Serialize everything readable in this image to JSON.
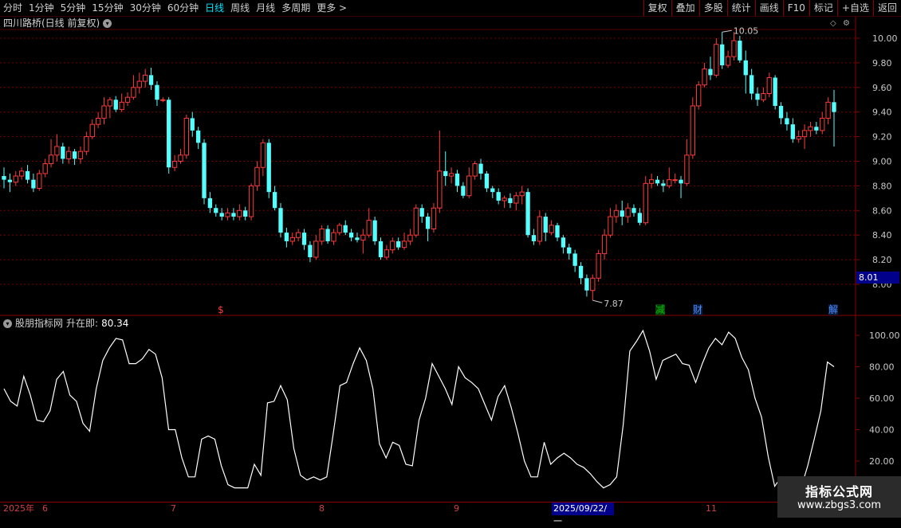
{
  "toolbar": {
    "periods": [
      {
        "label": "分时"
      },
      {
        "label": "1分钟"
      },
      {
        "label": "5分钟"
      },
      {
        "label": "15分钟"
      },
      {
        "label": "30分钟"
      },
      {
        "label": "60分钟"
      },
      {
        "label": "日线"
      },
      {
        "label": "周线"
      },
      {
        "label": "月线"
      },
      {
        "label": "多周期"
      },
      {
        "label": "更多 >"
      }
    ],
    "active_period": "日线",
    "buttons": [
      {
        "label": "复权"
      },
      {
        "label": "叠加"
      },
      {
        "label": "多股"
      },
      {
        "label": "统计"
      },
      {
        "label": "画线"
      },
      {
        "label": "F10"
      },
      {
        "label": "标记"
      },
      {
        "label": "+自选"
      },
      {
        "label": "返回"
      }
    ]
  },
  "main_chart": {
    "title": "四川路桥(日线 前复权)",
    "current_price_label": "8.01",
    "high_label": "10.05",
    "low_label": "7.87",
    "markers": {
      "s": "$",
      "jian": "减",
      "cai": "财",
      "jie": "解"
    }
  },
  "indicator": {
    "title": "股朋指标网",
    "line_label": "升在即:",
    "line_value": "80.34"
  },
  "dates": {
    "year": "2025年",
    "months": [
      "6",
      "7",
      "8",
      "9",
      "11"
    ],
    "cursor": "2025/09/22/一"
  },
  "watermark": {
    "title": "指标公式网",
    "url": "www.zbgs3.com"
  },
  "colors": {
    "up": "#ff3b3b",
    "down": "#54ffff",
    "grid": "#7a0000",
    "indicator_line": "#ffffff"
  },
  "chart_data": [
    {
      "type": "candlestick",
      "title": "四川路桥(日线 前复权)",
      "y_ticks": [
        8.0,
        8.2,
        8.4,
        8.6,
        8.8,
        9.0,
        9.2,
        9.4,
        9.6,
        9.8,
        10.0
      ],
      "ylim": [
        7.9,
        10.1
      ],
      "candles": [
        [
          8.88,
          8.85,
          8.95,
          8.78
        ],
        [
          8.85,
          8.83,
          8.9,
          8.75
        ],
        [
          8.83,
          8.88,
          8.92,
          8.8
        ],
        [
          8.88,
          8.92,
          8.95,
          8.85
        ],
        [
          8.92,
          8.85,
          8.97,
          8.82
        ],
        [
          8.85,
          8.78,
          8.9,
          8.75
        ],
        [
          8.78,
          8.9,
          8.93,
          8.76
        ],
        [
          8.9,
          8.98,
          9.02,
          8.87
        ],
        [
          8.98,
          9.05,
          9.18,
          8.95
        ],
        [
          9.05,
          9.12,
          9.22,
          9.0
        ],
        [
          9.12,
          9.02,
          9.15,
          8.98
        ],
        [
          9.02,
          9.08,
          9.12,
          8.98
        ],
        [
          9.08,
          9.02,
          9.1,
          8.97
        ],
        [
          9.02,
          9.08,
          9.12,
          8.98
        ],
        [
          9.08,
          9.2,
          9.24,
          9.05
        ],
        [
          9.2,
          9.3,
          9.34,
          9.18
        ],
        [
          9.3,
          9.35,
          9.4,
          9.27
        ],
        [
          9.35,
          9.45,
          9.52,
          9.3
        ],
        [
          9.45,
          9.5,
          9.52,
          9.35
        ],
        [
          9.5,
          9.42,
          9.53,
          9.4
        ],
        [
          9.42,
          9.48,
          9.55,
          9.4
        ],
        [
          9.48,
          9.52,
          9.56,
          9.45
        ],
        [
          9.52,
          9.6,
          9.7,
          9.5
        ],
        [
          9.6,
          9.65,
          9.72,
          9.55
        ],
        [
          9.65,
          9.7,
          9.75,
          9.6
        ],
        [
          9.7,
          9.62,
          9.76,
          9.58
        ],
        [
          9.62,
          9.5,
          9.65,
          9.45
        ],
        [
          9.5,
          9.5,
          9.52,
          9.48
        ],
        [
          9.5,
          8.95,
          9.52,
          8.9
        ],
        [
          8.95,
          9.0,
          9.05,
          8.92
        ],
        [
          9.0,
          9.05,
          9.1,
          8.98
        ],
        [
          9.05,
          9.35,
          9.38,
          9.02
        ],
        [
          9.35,
          9.25,
          9.4,
          9.2
        ],
        [
          9.25,
          9.15,
          9.28,
          9.1
        ],
        [
          9.15,
          8.7,
          9.18,
          8.65
        ],
        [
          8.7,
          8.62,
          8.75,
          8.58
        ],
        [
          8.62,
          8.58,
          8.65,
          8.55
        ],
        [
          8.58,
          8.55,
          8.62,
          8.52
        ],
        [
          8.55,
          8.58,
          8.62,
          8.52
        ],
        [
          8.58,
          8.55,
          8.62,
          8.52
        ],
        [
          8.55,
          8.6,
          8.65,
          8.52
        ],
        [
          8.6,
          8.55,
          8.63,
          8.52
        ],
        [
          8.55,
          8.8,
          8.82,
          8.52
        ],
        [
          8.8,
          8.95,
          9.0,
          8.76
        ],
        [
          8.95,
          9.15,
          9.18,
          8.88
        ],
        [
          9.15,
          8.75,
          9.18,
          8.7
        ],
        [
          8.75,
          8.62,
          8.8,
          8.6
        ],
        [
          8.62,
          8.42,
          8.66,
          8.38
        ],
        [
          8.42,
          8.35,
          8.46,
          8.3
        ],
        [
          8.35,
          8.38,
          8.42,
          8.32
        ],
        [
          8.38,
          8.42,
          8.45,
          8.35
        ],
        [
          8.42,
          8.32,
          8.45,
          8.28
        ],
        [
          8.32,
          8.22,
          8.35,
          8.18
        ],
        [
          8.22,
          8.35,
          8.4,
          8.2
        ],
        [
          8.35,
          8.45,
          8.48,
          8.32
        ],
        [
          8.45,
          8.35,
          8.48,
          8.33
        ],
        [
          8.35,
          8.42,
          8.45,
          8.32
        ],
        [
          8.42,
          8.48,
          8.5,
          8.4
        ],
        [
          8.48,
          8.42,
          8.52,
          8.4
        ],
        [
          8.42,
          8.38,
          8.45,
          8.35
        ],
        [
          8.38,
          8.36,
          8.42,
          8.34
        ],
        [
          8.36,
          8.4,
          8.45,
          8.25
        ],
        [
          8.4,
          8.52,
          8.62,
          8.38
        ],
        [
          8.52,
          8.35,
          8.55,
          8.32
        ],
        [
          8.35,
          8.22,
          8.38,
          8.2
        ],
        [
          8.22,
          8.28,
          8.32,
          8.2
        ],
        [
          8.28,
          8.35,
          8.38,
          8.25
        ],
        [
          8.35,
          8.3,
          8.38,
          8.28
        ],
        [
          8.3,
          8.35,
          8.42,
          8.28
        ],
        [
          8.35,
          8.4,
          8.45,
          8.32
        ],
        [
          8.4,
          8.62,
          8.65,
          8.38
        ],
        [
          8.62,
          8.55,
          8.65,
          8.5
        ],
        [
          8.55,
          8.45,
          8.58,
          8.35
        ],
        [
          8.45,
          8.62,
          8.66,
          8.42
        ],
        [
          8.62,
          8.92,
          9.25,
          8.58
        ],
        [
          8.92,
          8.88,
          9.08,
          8.8
        ],
        [
          8.88,
          8.9,
          8.95,
          8.82
        ],
        [
          8.9,
          8.8,
          8.93,
          8.75
        ],
        [
          8.8,
          8.72,
          8.83,
          8.7
        ],
        [
          8.72,
          8.88,
          8.95,
          8.7
        ],
        [
          8.88,
          8.98,
          9.0,
          8.85
        ],
        [
          8.98,
          8.9,
          9.02,
          8.85
        ],
        [
          8.9,
          8.78,
          8.92,
          8.75
        ],
        [
          8.78,
          8.75,
          8.8,
          8.7
        ],
        [
          8.75,
          8.68,
          8.78,
          8.65
        ],
        [
          8.68,
          8.7,
          8.72,
          8.62
        ],
        [
          8.7,
          8.66,
          8.74,
          8.62
        ],
        [
          8.66,
          8.72,
          8.75,
          8.6
        ],
        [
          8.72,
          8.75,
          8.8,
          8.65
        ],
        [
          8.75,
          8.4,
          8.78,
          8.38
        ],
        [
          8.4,
          8.35,
          8.45,
          8.32
        ],
        [
          8.35,
          8.55,
          8.6,
          8.32
        ],
        [
          8.55,
          8.42,
          8.58,
          8.35
        ],
        [
          8.42,
          8.48,
          8.52,
          8.4
        ],
        [
          8.48,
          8.38,
          8.5,
          8.35
        ],
        [
          8.38,
          8.3,
          8.4,
          8.25
        ],
        [
          8.3,
          8.25,
          8.33,
          8.2
        ],
        [
          8.25,
          8.15,
          8.28,
          8.1
        ],
        [
          8.15,
          8.05,
          8.18,
          8.0
        ],
        [
          8.05,
          7.95,
          8.08,
          7.9
        ],
        [
          7.95,
          8.05,
          8.08,
          7.87
        ],
        [
          8.05,
          8.25,
          8.28,
          8.02
        ],
        [
          8.25,
          8.4,
          8.45,
          8.2
        ],
        [
          8.4,
          8.55,
          8.62,
          8.38
        ],
        [
          8.55,
          8.6,
          8.65,
          8.5
        ],
        [
          8.6,
          8.55,
          8.68,
          8.48
        ],
        [
          8.55,
          8.62,
          8.66,
          8.5
        ],
        [
          8.62,
          8.58,
          8.65,
          8.55
        ],
        [
          8.58,
          8.5,
          8.62,
          8.48
        ],
        [
          8.5,
          8.82,
          8.88,
          8.48
        ],
        [
          8.82,
          8.85,
          8.9,
          8.78
        ],
        [
          8.85,
          8.82,
          8.88,
          8.8
        ],
        [
          8.82,
          8.8,
          8.85,
          8.75
        ],
        [
          8.8,
          8.85,
          8.95,
          8.78
        ],
        [
          8.85,
          8.85,
          8.9,
          8.82
        ],
        [
          8.85,
          8.82,
          8.88,
          8.7
        ],
        [
          8.82,
          9.05,
          9.18,
          8.8
        ],
        [
          9.05,
          9.45,
          9.52,
          9.02
        ],
        [
          9.45,
          9.62,
          9.65,
          9.42
        ],
        [
          9.62,
          9.75,
          9.8,
          9.6
        ],
        [
          9.75,
          9.7,
          9.85,
          9.66
        ],
        [
          9.7,
          9.95,
          10.0,
          9.68
        ],
        [
          9.95,
          9.78,
          10.05,
          9.75
        ],
        [
          9.78,
          9.85,
          9.9,
          9.76
        ],
        [
          9.85,
          9.98,
          10.05,
          9.82
        ],
        [
          9.98,
          9.82,
          10.02,
          9.8
        ],
        [
          9.82,
          9.7,
          9.9,
          9.55
        ],
        [
          9.7,
          9.55,
          9.75,
          9.5
        ],
        [
          9.55,
          9.5,
          9.6,
          9.45
        ],
        [
          9.5,
          9.55,
          9.6,
          9.48
        ],
        [
          9.55,
          9.68,
          9.72,
          9.52
        ],
        [
          9.68,
          9.45,
          9.7,
          9.42
        ],
        [
          9.45,
          9.35,
          9.48,
          9.3
        ],
        [
          9.35,
          9.3,
          9.4,
          9.25
        ],
        [
          9.3,
          9.18,
          9.35,
          9.15
        ],
        [
          9.18,
          9.2,
          9.25,
          9.15
        ],
        [
          9.2,
          9.25,
          9.3,
          9.1
        ],
        [
          9.25,
          9.28,
          9.32,
          9.2
        ],
        [
          9.28,
          9.25,
          9.32,
          9.22
        ],
        [
          9.25,
          9.35,
          9.4,
          9.22
        ],
        [
          9.35,
          9.48,
          9.52,
          9.3
        ],
        [
          9.48,
          9.4,
          9.58,
          9.12
        ]
      ]
    },
    {
      "type": "line",
      "title": "股朋指标网",
      "series": [
        {
          "name": "升在即",
          "values": [
            66,
            58,
            55,
            74,
            62,
            46,
            45,
            52,
            72,
            77,
            62,
            58,
            44,
            39,
            66,
            84,
            92,
            98,
            97,
            82,
            82,
            85,
            91,
            88,
            73,
            40,
            40,
            22,
            10,
            10,
            34,
            36,
            34,
            17,
            5,
            3,
            3,
            3,
            18,
            11,
            57,
            58,
            68,
            59,
            28,
            11,
            8,
            10,
            8,
            10,
            38,
            68,
            70,
            82,
            92,
            84,
            66,
            31,
            22,
            32,
            30,
            18,
            17,
            46,
            60,
            82,
            74,
            66,
            56,
            80,
            73,
            70,
            66,
            56,
            46,
            61,
            68,
            54,
            38,
            20,
            10,
            10,
            32,
            18,
            22,
            25,
            22,
            18,
            16,
            12,
            7,
            3,
            5,
            10,
            43,
            90,
            96,
            103,
            90,
            72,
            84,
            86,
            88,
            82,
            81,
            70,
            82,
            92,
            98,
            94,
            102,
            98,
            86,
            78,
            60,
            48,
            23,
            4,
            10,
            3,
            3,
            3,
            17,
            34,
            52,
            83,
            80
          ]
        }
      ],
      "y_ticks": [
        20.0,
        40.0,
        60.0,
        80.0,
        100.0
      ],
      "ylim": [
        0,
        110
      ]
    }
  ]
}
